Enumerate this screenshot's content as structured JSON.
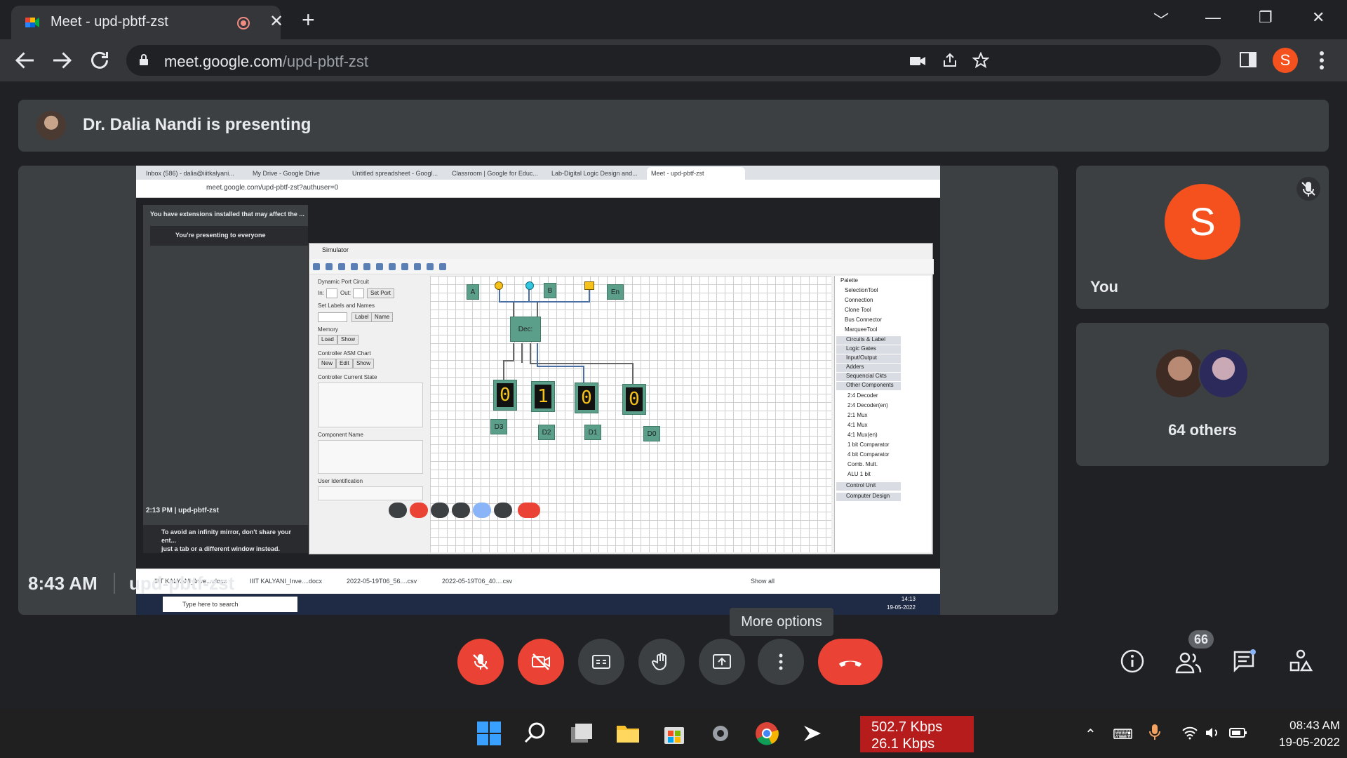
{
  "browser": {
    "tab_title": "Meet - upd-pbtf-zst",
    "tab_close": "✕",
    "new_tab": "+",
    "url_host": "meet.google.com",
    "url_path": "/upd-pbtf-zst",
    "profile_initial": "S",
    "window_controls": [
      "﹀",
      "—",
      "❐",
      "✕"
    ]
  },
  "meet": {
    "presenting_text": "Dr. Dalia Nandi is presenting",
    "you_label": "You",
    "you_initial": "S",
    "others_label": "64 others",
    "tooltip": "More options",
    "time": "8:43 AM",
    "meeting_code": "upd-pbtf-zst",
    "participants_badge": "66",
    "accent_red": "#ea4335",
    "avatar_color": "#f4511e"
  },
  "shared_screen": {
    "tabs": [
      "Inbox (586) - dalia@iiitkalyani...",
      "My Drive - Google Drive",
      "Untitled spreadsheet - Googl...",
      "Classroom | Google for Educ...",
      "Lab-Digital Logic Design and...",
      "Meet - upd-pbtf-zst"
    ],
    "url": "meet.google.com/upd-pbtf-zst?authuser=0",
    "extensions_note": "You have extensions installed that may affect the ...",
    "presenting_note": "You're presenting to everyone",
    "mirror_note_line1": "To avoid an infinity mirror, don't share your ent...",
    "mirror_note_line2": "just a tab or a different window instead.",
    "time": "2:13 PM",
    "code": "upd-pbtf-zst",
    "downloads": [
      "IIIT KALYANI_Inve....docx",
      "IIIT KALYANI_Inve....docx",
      "2022-05-19T06_56....csv",
      "2022-05-19T06_40....csv"
    ],
    "show_all": "Show all",
    "search_placeholder": "Type here to search",
    "clock_time": "14:13",
    "clock_date": "19-05-2022"
  },
  "simulator": {
    "title": "Simulator",
    "dynamic_port": "Dynamic Port Circuit",
    "in_label": "In:",
    "out_label": "Out:",
    "set_port": "Set Port",
    "set_labels": "Set Labels and Names",
    "label_btn": "Label",
    "name_btn": "Name",
    "memory": "Memory",
    "load_btn": "Load",
    "show_btn": "Show",
    "asm_chart": "Controller ASM Chart",
    "new_btn": "New",
    "edit_btn": "Edit",
    "show_btn2": "Show",
    "current_state": "Controller Current State",
    "component_name": "Component Name",
    "user_id": "User Identification",
    "inputs": [
      "A",
      "B",
      "En"
    ],
    "decoder_label": "Dec:",
    "displays": [
      "0",
      "1",
      "0",
      "0"
    ],
    "outputs": [
      "D3",
      "D2",
      "D1",
      "D0"
    ],
    "palette_title": "Palette",
    "palette_tools": [
      "SelectionTool",
      "Connection",
      "Clone Tool",
      "Bus Connector",
      "MarqueeTool"
    ],
    "palette_groups": [
      "Circuits & Label",
      "Logic Gates",
      "Input/Output",
      "Adders",
      "Sequencial Ckts",
      "Other Components"
    ],
    "palette_items": [
      "2:4 Decoder",
      "2:4 Decoder(en)",
      "2:1 Mux",
      "4:1 Mux",
      "4:1 Mux(en)",
      "1 bit Comparator",
      "4 bit Comparator",
      "Comb. Mult.",
      "ALU 1 bit"
    ],
    "palette_bottom": [
      "Control Unit",
      "Computer Design"
    ]
  },
  "taskbar": {
    "net_up": "502.7 Kbps",
    "net_down": "26.1 Kbps",
    "clock_time": "08:43 AM",
    "clock_date": "19-05-2022"
  }
}
